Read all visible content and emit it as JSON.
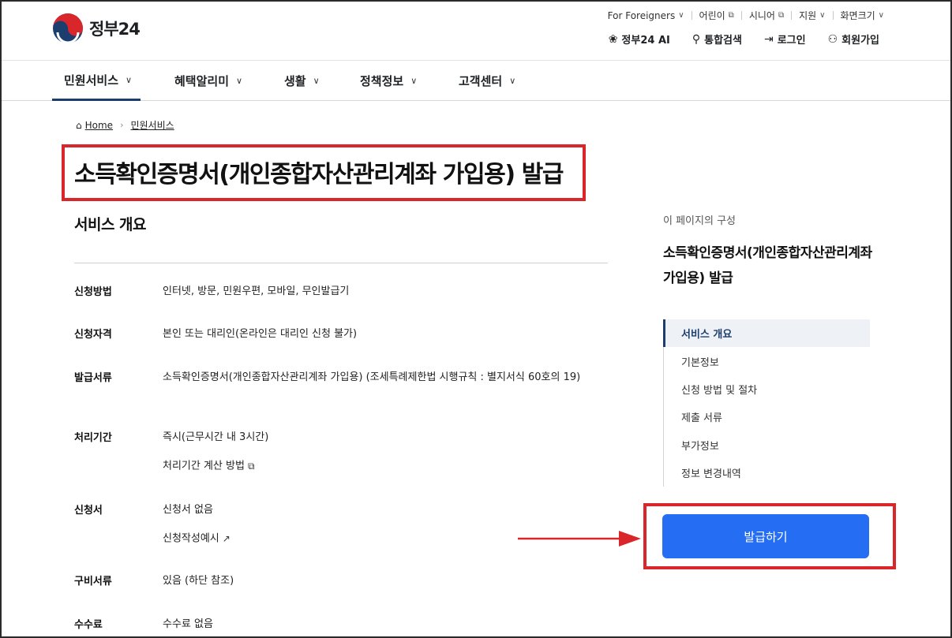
{
  "header": {
    "logo_text": "정부24",
    "util_nav": [
      {
        "label": "For Foreigners",
        "icon": "chevron-down-icon",
        "glyph": "∨"
      },
      {
        "label": "어린이",
        "icon": "external-link-icon",
        "glyph": "⧉"
      },
      {
        "label": "시니어",
        "icon": "external-link-icon",
        "glyph": "⧉"
      },
      {
        "label": "지원",
        "icon": "chevron-down-icon",
        "glyph": "∨"
      },
      {
        "label": "화면크기",
        "icon": "chevron-down-icon",
        "glyph": "∨"
      }
    ],
    "main_util": [
      {
        "label": "정부24 AI",
        "icon": "ai-icon",
        "glyph": "❀"
      },
      {
        "label": "통합검색",
        "icon": "search-icon",
        "glyph": "⚲"
      },
      {
        "label": "로그인",
        "icon": "login-icon",
        "glyph": "⇥"
      },
      {
        "label": "회원가입",
        "icon": "user-add-icon",
        "glyph": "⚇"
      }
    ]
  },
  "gnb": [
    {
      "label": "민원서비스",
      "active": true
    },
    {
      "label": "혜택알리미",
      "active": false
    },
    {
      "label": "생활",
      "active": false
    },
    {
      "label": "정책정보",
      "active": false
    },
    {
      "label": "고객센터",
      "active": false
    }
  ],
  "breadcrumb": {
    "home": "Home",
    "current": "민원서비스"
  },
  "page": {
    "title": "소득확인증명서(개인종합자산관리계좌 가입용) 발급",
    "section_title": "서비스 개요"
  },
  "info": {
    "method_label": "신청방법",
    "method_value": "인터넷, 방문, 민원우편, 모바일, 무인발급기",
    "qualify_label": "신청자격",
    "qualify_value": "본인 또는 대리인(온라인은 대리인 신청 불가)",
    "doc_label": "발급서류",
    "doc_value": "소득확인증명서(개인종합자산관리계좌 가입용) (조세특례제한법 시행규칙 : 별지서식 60호의 19)",
    "period_label": "처리기간",
    "period_value": "즉시(근무시간 내 3시간)",
    "period_link": "처리기간 계산 방법",
    "form_label": "신청서",
    "form_value": "신청서 없음",
    "form_link": "신청작성예시",
    "required_label": "구비서류",
    "required_value": "있음 (하단 참조)",
    "fee_label": "수수료",
    "fee_value": "수수료 없음"
  },
  "side": {
    "caption": "이 페이지의 구성",
    "title": "소득확인증명서(개인종합자산관리계좌 가입용) 발급",
    "toc": [
      {
        "label": "서비스 개요",
        "active": true
      },
      {
        "label": "기본정보",
        "active": false
      },
      {
        "label": "신청 방법 및 절차",
        "active": false
      },
      {
        "label": "제출 서류",
        "active": false
      },
      {
        "label": "부가정보",
        "active": false
      },
      {
        "label": "정보 변경내역",
        "active": false
      }
    ],
    "button": "발급하기"
  },
  "colors": {
    "accent": "#256ef4",
    "navy": "#1c3e6f",
    "highlight": "#d9262b"
  }
}
